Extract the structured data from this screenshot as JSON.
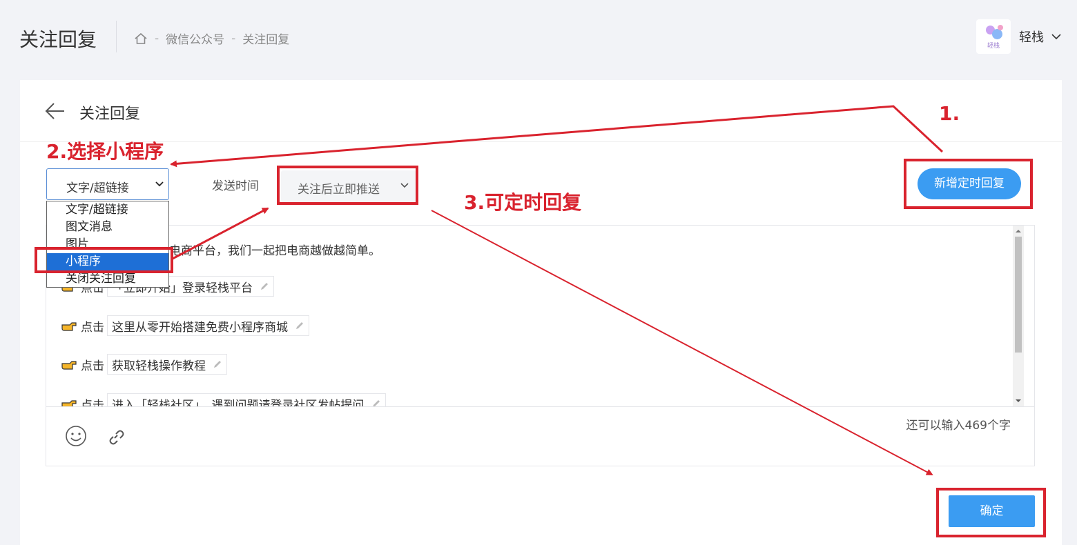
{
  "header": {
    "title": "关注回复",
    "breadcrumb": [
      "微信公众号",
      "关注回复"
    ],
    "breadcrumb_sep": "-",
    "user_name": "轻栈",
    "logo_text": "轻栈"
  },
  "card": {
    "title": "关注回复"
  },
  "type_select": {
    "value": "文字/超链接",
    "options": [
      "文字/超链接",
      "图文消息",
      "图片",
      "小程序",
      "关闭关注回复"
    ],
    "highlighted": "小程序"
  },
  "send_time": {
    "label": "发送时间",
    "value": "关注后立即推送"
  },
  "buttons": {
    "add_timed": "新增定时回复",
    "confirm": "确定"
  },
  "editor": {
    "intro": "电商平台，我们一起把电商越做越简单。",
    "lines": [
      {
        "prefix": "点击",
        "chip": "「立即开始」登录轻栈平台"
      },
      {
        "prefix": "点击",
        "chip": "这里从零开始搭建免费小程序商城"
      },
      {
        "prefix": "点击",
        "chip": "获取轻栈操作教程"
      },
      {
        "prefix": "点击",
        "chip": "进入「轻栈社区」，遇到问题请登录社区发帖提问"
      }
    ],
    "counter": "还可以输入469个字"
  },
  "annotations": {
    "step1": "1.",
    "step2": "2.选择小程序",
    "step3": "3.可定时回复"
  },
  "colors": {
    "accent": "#3b9cf2",
    "annotation": "#d9232e",
    "selected_option": "#1e6fd6"
  }
}
